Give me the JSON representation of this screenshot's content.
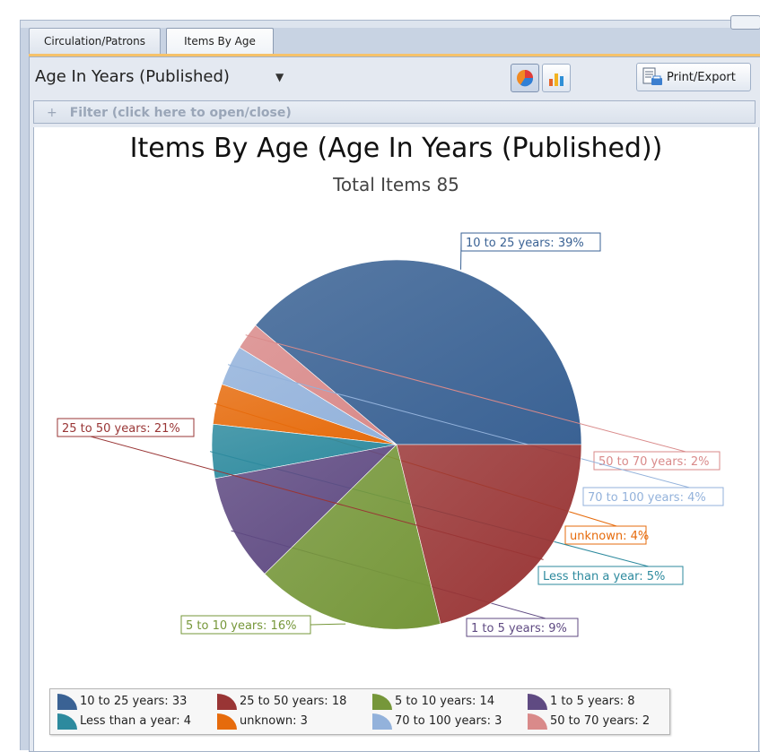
{
  "tabs": [
    {
      "label": "Circulation/Patrons",
      "active": false
    },
    {
      "label": "Items By Age",
      "active": true
    }
  ],
  "toolbar": {
    "age_select_value": "Age In Years (Published)",
    "pie_toggle_pressed": true,
    "bar_toggle_pressed": false,
    "print_label": "Print/Export"
  },
  "filter": {
    "plus": "+",
    "label": "Filter (click here to open/close)"
  },
  "chart_data": {
    "type": "pie",
    "title": "Items By Age (Age In Years (Published))",
    "subtitle": "Total Items 85",
    "slices": [
      {
        "name": "10 to 25 years",
        "count": 33,
        "percent": 39,
        "label": "10 to 25 years: 39%",
        "legend": "10 to 25 years: 33",
        "color": "#3a6294"
      },
      {
        "name": "50 to 70 years",
        "count": 2,
        "percent": 2,
        "label": "50 to 70 years: 2%",
        "legend": "50 to 70 years: 2",
        "color": "#d98a8a"
      },
      {
        "name": "70 to 100 years",
        "count": 3,
        "percent": 4,
        "label": "70 to 100 years: 4%",
        "legend": "70 to 100 years: 3",
        "color": "#93b2db"
      },
      {
        "name": "unknown",
        "count": 3,
        "percent": 4,
        "label": "unknown: 4%",
        "legend": "unknown: 3",
        "color": "#e66b0c"
      },
      {
        "name": "Less than a year",
        "count": 4,
        "percent": 5,
        "label": "Less than a year: 5%",
        "legend": "Less than a year: 4",
        "color": "#2d8a9e"
      },
      {
        "name": "1 to 5 years",
        "count": 8,
        "percent": 9,
        "label": "1 to 5 years: 9%",
        "legend": "1 to 5 years: 8",
        "color": "#5f4a82"
      },
      {
        "name": "5 to 10 years",
        "count": 14,
        "percent": 16,
        "label": "5 to 10 years: 16%",
        "legend": "5 to 10 years: 14",
        "color": "#76973a"
      },
      {
        "name": "25 to 50 years",
        "count": 18,
        "percent": 21,
        "label": "25 to 50 years: 21%",
        "legend": "25 to 50 years: 18",
        "color": "#993535"
      }
    ],
    "legend_order": [
      "10 to 25 years",
      "25 to 50 years",
      "5 to 10 years",
      "1 to 5 years",
      "Less than a year",
      "unknown",
      "70 to 100 years",
      "50 to 70 years"
    ]
  }
}
